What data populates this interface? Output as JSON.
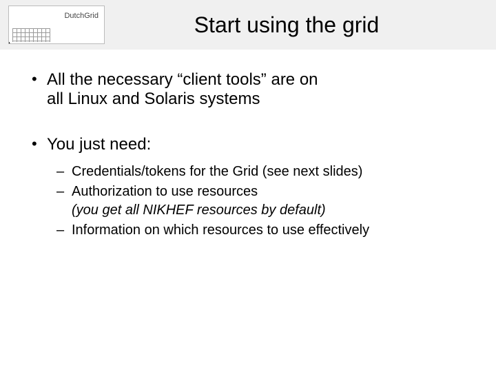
{
  "header": {
    "logo_text": "DutchGrid",
    "title": "Start using the grid"
  },
  "bullets": [
    {
      "line1": "All the necessary “client tools” are on",
      "line2": "all Linux and Solaris systems"
    },
    {
      "line1": "You just need:",
      "subs": [
        {
          "text": "Credentials/tokens for the Grid (see next slides)"
        },
        {
          "text": "Authorization to use resources",
          "italic_detail": "(you get all NIKHEF resources by default)"
        },
        {
          "text": "Information on which resources to use effectively"
        }
      ]
    }
  ]
}
